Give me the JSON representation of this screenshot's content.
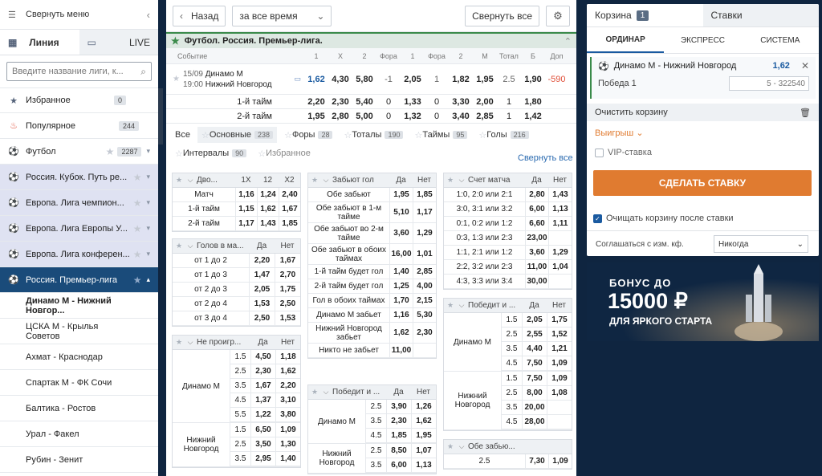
{
  "sidebar": {
    "collapse_label": "Свернуть меню",
    "tab_line": "Линия",
    "tab_live": "LIVE",
    "search_placeholder": "Введите название лиги, к...",
    "items": [
      {
        "label": "Избранное",
        "badge": "0"
      },
      {
        "label": "Популярное",
        "badge": "244"
      },
      {
        "label": "Футбол",
        "badge": "2287"
      }
    ],
    "leagues": [
      "Россия. Кубок. Путь ре...",
      "Европа. Лига чемпион...",
      "Европа. Лига Европы У...",
      "Европа. Лига конферен..."
    ],
    "selected_league": "Россия. Премьер-лига",
    "matches": [
      "Динамо М - Нижний Новгор...",
      "ЦСКА М - Крылья Советов",
      "Ахмат - Краснодар",
      "Спартак М - ФК Сочи",
      "Балтика - Ростов",
      "Урал - Факел",
      "Рубин - Зенит"
    ]
  },
  "toolbar": {
    "back": "Назад",
    "period": "за все время",
    "collapse_all": "Свернуть все"
  },
  "league_header": "Футбол. Россия. Премьер-лига.",
  "columns": [
    "Событие",
    "1",
    "X",
    "2",
    "Фора",
    "1",
    "Фора",
    "2",
    "М",
    "Тотал",
    "Б",
    "Доп"
  ],
  "event": {
    "date": "15/09",
    "time": "19:00",
    "team1": "Динамо М",
    "team2": "Нижний Новгород",
    "odds": [
      "1,62",
      "4,30",
      "5,80",
      "-1",
      "2,05",
      "1",
      "1,82",
      "1,95",
      "2.5",
      "1,90",
      "-590"
    ]
  },
  "halves": [
    {
      "label": "1-й тайм",
      "odds": [
        "2,20",
        "2,30",
        "5,40",
        "0",
        "1,33",
        "0",
        "3,30",
        "2,00",
        "1",
        "1,80"
      ]
    },
    {
      "label": "2-й тайм",
      "odds": [
        "1,95",
        "2,80",
        "5,00",
        "0",
        "1,32",
        "0",
        "3,40",
        "2,85",
        "1",
        "1,42"
      ]
    }
  ],
  "filters": [
    {
      "label": "Все",
      "count": ""
    },
    {
      "label": "Основные",
      "count": "238"
    },
    {
      "label": "Форы",
      "count": "28"
    },
    {
      "label": "Тоталы",
      "count": "190"
    },
    {
      "label": "Таймы",
      "count": "95"
    },
    {
      "label": "Голы",
      "count": "216"
    },
    {
      "label": "Интервалы",
      "count": "90"
    },
    {
      "label": "Избранное",
      "count": ""
    }
  ],
  "filters_collapse": "Свернуть все",
  "markets": {
    "double_chance": {
      "title": "Дво...",
      "cols": [
        "1X",
        "12",
        "X2"
      ],
      "rows": [
        [
          "Матч",
          "1,16",
          "1,24",
          "2,40"
        ],
        [
          "1-й тайм",
          "1,15",
          "1,62",
          "1,67"
        ],
        [
          "2-й тайм",
          "1,17",
          "1,43",
          "1,85"
        ]
      ]
    },
    "goals_in_match": {
      "title": "Голов в ма...",
      "cols": [
        "Да",
        "Нет"
      ],
      "rows": [
        [
          "от 1 до 2",
          "2,20",
          "1,67"
        ],
        [
          "от 1 до 3",
          "1,47",
          "2,70"
        ],
        [
          "от 2 до 3",
          "2,05",
          "1,75"
        ],
        [
          "от 2 до 4",
          "1,53",
          "2,50"
        ],
        [
          "от 3 до 4",
          "2,50",
          "1,53"
        ]
      ]
    },
    "not_lose": {
      "title": "Не проигр...",
      "cols": [
        "Да",
        "Нет"
      ],
      "team1": "Динамо М",
      "team2": "Нижний Новгород",
      "rows1": [
        [
          "1.5",
          "4,50",
          "1,18"
        ],
        [
          "2.5",
          "2,30",
          "1,62"
        ],
        [
          "3.5",
          "1,67",
          "2,20"
        ],
        [
          "4.5",
          "1,37",
          "3,10"
        ],
        [
          "5.5",
          "1,22",
          "3,80"
        ]
      ],
      "rows2": [
        [
          "1.5",
          "6,50",
          "1,09"
        ],
        [
          "2.5",
          "3,50",
          "1,30"
        ],
        [
          "3.5",
          "2,95",
          "1,40"
        ]
      ]
    },
    "score_goal": {
      "title": "Забьют гол",
      "cols": [
        "Да",
        "Нет"
      ],
      "rows": [
        [
          "Обе забьют",
          "1,95",
          "1,85"
        ],
        [
          "Обе забьют в 1-м тайме",
          "5,10",
          "1,17"
        ],
        [
          "Обе забьют во 2-м тайме",
          "3,60",
          "1,29"
        ],
        [
          "Обе забьют в обоих таймах",
          "16,00",
          "1,01"
        ],
        [
          "1-й тайм будет гол",
          "1,40",
          "2,85"
        ],
        [
          "2-й тайм будет гол",
          "1,25",
          "4,00"
        ],
        [
          "Гол в обоих таймах",
          "1,70",
          "2,15"
        ],
        [
          "Динамо М забьет",
          "1,16",
          "5,30"
        ],
        [
          "Нижний Новгород забьет",
          "1,62",
          "2,30"
        ],
        [
          "Никто не забьет",
          "11,00",
          ""
        ]
      ]
    },
    "win_and": {
      "title": "Победит и ...",
      "cols": [
        "Да",
        "Нет"
      ],
      "team1": "Динамо М",
      "team2": "Нижний Новгород",
      "rows1": [
        [
          "2.5",
          "3,90",
          "1,26"
        ],
        [
          "3.5",
          "2,30",
          "1,62"
        ],
        [
          "4.5",
          "1,85",
          "1,95"
        ]
      ],
      "rows2": [
        [
          "2.5",
          "8,50",
          "1,07"
        ],
        [
          "3.5",
          "6,00",
          "1,13"
        ]
      ]
    },
    "match_score": {
      "title": "Счет матча",
      "cols": [
        "Да",
        "Нет"
      ],
      "rows": [
        [
          "1:0, 2:0 или 2:1",
          "2,80",
          "1,43"
        ],
        [
          "3:0, 3:1 или 3:2",
          "6,00",
          "1,13"
        ],
        [
          "0:1, 0:2 или 1:2",
          "6,60",
          "1,11"
        ],
        [
          "0:3, 1:3 или 2:3",
          "23,00",
          ""
        ],
        [
          "1:1, 2:1 или 1:2",
          "3,60",
          "1,29"
        ],
        [
          "2:2, 3:2 или 2:3",
          "11,00",
          "1,04"
        ],
        [
          "4:3, 3:3 или 3:4",
          "30,00",
          ""
        ]
      ]
    },
    "win_and2": {
      "title": "Победит и ...",
      "cols": [
        "Да",
        "Нет"
      ],
      "team1": "Динамо М",
      "team2": "Нижний Новгород",
      "rows1": [
        [
          "1.5",
          "2,05",
          "1,75"
        ],
        [
          "2.5",
          "2,55",
          "1,52"
        ],
        [
          "3.5",
          "4,40",
          "1,21"
        ],
        [
          "4.5",
          "7,50",
          "1,09"
        ]
      ],
      "rows2": [
        [
          "1.5",
          "7,50",
          "1,09"
        ],
        [
          "2.5",
          "8,00",
          "1,08"
        ],
        [
          "3.5",
          "20,00",
          ""
        ],
        [
          "4.5",
          "28,00",
          ""
        ]
      ]
    },
    "both_score": {
      "title": "Обе забью...",
      "rows": [
        [
          "2.5",
          "7,30",
          "1,09"
        ]
      ]
    }
  },
  "betslip": {
    "tab_cart": "Корзина",
    "cart_count": "1",
    "tab_bets": "Ставки",
    "types": [
      "ОРДИНАР",
      "ЭКСПРЕСС",
      "СИСТЕМА"
    ],
    "bet_match": "Динамо М - Нижний Новгород",
    "bet_odds": "1,62",
    "bet_outcome": "Победа 1",
    "stake_placeholder": "5 - 322540",
    "clear_label": "Очистить корзину",
    "winnings_label": "Выигрыш",
    "vip_label": "VIP-ставка",
    "place_bet": "СДЕЛАТЬ СТАВКУ",
    "clear_after": "Очищать корзину после ставки",
    "agree_label": "Соглашаться с изм. кф.",
    "agree_value": "Никогда"
  },
  "promo": {
    "line1": "БОНУС ДО",
    "line2": "15000 ₽",
    "line3": "ДЛЯ ЯРКОГО СТАРТА"
  }
}
